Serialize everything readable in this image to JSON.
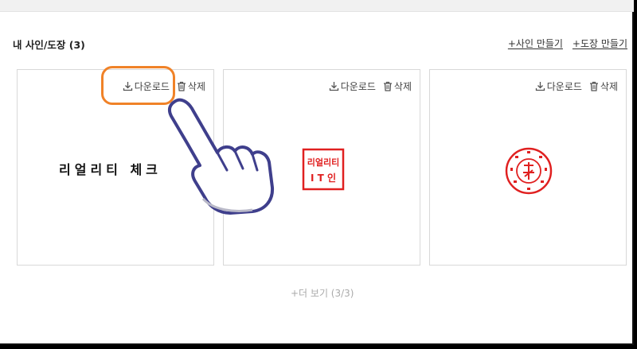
{
  "section": {
    "title": "내 사인/도장 (3)",
    "add_sign_label": "+사인 만들기",
    "add_stamp_label": "+도장 만들기"
  },
  "cards": [
    {
      "download_label": "다운로드",
      "delete_label": "삭제",
      "signature_text": "리얼리티 체크"
    },
    {
      "download_label": "다운로드",
      "delete_label": "삭제",
      "stamp_text": "리얼리티 IT인"
    },
    {
      "download_label": "다운로드",
      "delete_label": "삭제"
    }
  ],
  "more_label": "+더 보기 (3/3)",
  "colors": {
    "accent": "#f08228",
    "stamp_red": "#e02020",
    "hand_outline": "#3f3f8c"
  }
}
